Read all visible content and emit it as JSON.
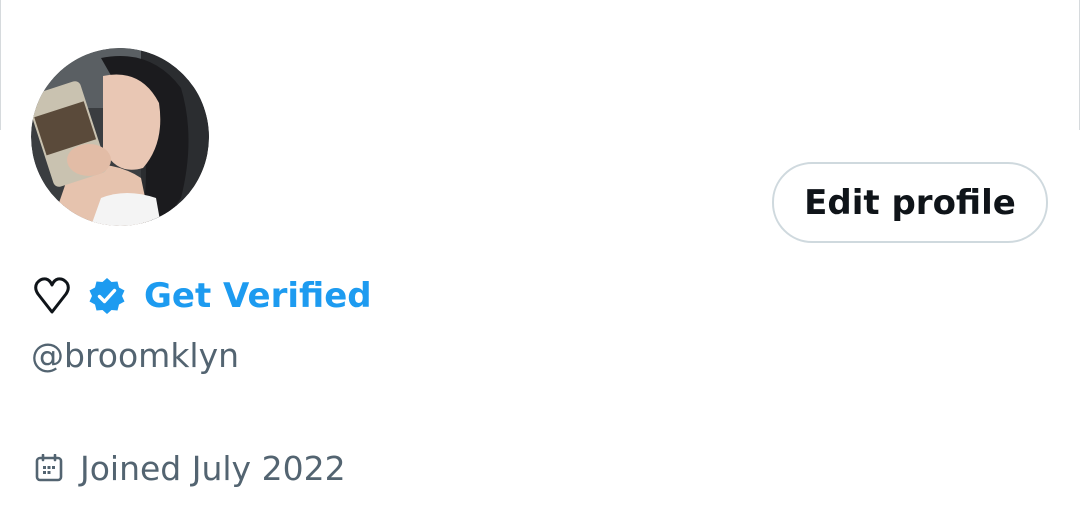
{
  "profile": {
    "display_name_icon": "heart-outline-icon",
    "verified_badge_icon": "verified-badge-icon",
    "get_verified_label": "Get Verified",
    "handle": "@broomklyn",
    "joined_icon": "calendar-icon",
    "joined_text": "Joined July 2022",
    "avatar_alt": "profile-photo"
  },
  "actions": {
    "edit_profile_label": "Edit profile"
  },
  "colors": {
    "accent": "#1d9bf0",
    "text_primary": "#0f1419",
    "text_secondary": "#536471",
    "button_border": "#cfd9de"
  }
}
